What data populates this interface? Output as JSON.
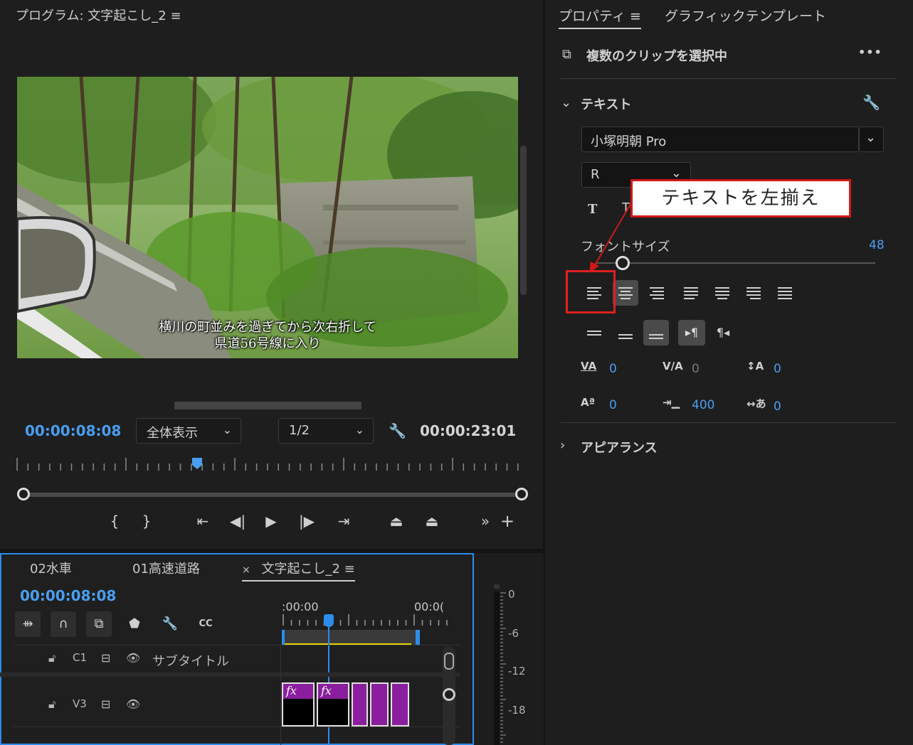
{
  "program": {
    "title": "プログラム: 文字起こし_2",
    "menu_icon": "≡",
    "subtitle_line1": "横川の町並みを過ぎてから次右折して",
    "subtitle_line2": "県道56号線に入り",
    "timecode_current": "00:00:08:08",
    "zoom_select": "全体表示",
    "resolution_select": "1/2",
    "timecode_duration": "00:00:23:01"
  },
  "timeline": {
    "tabs": [
      "02水車",
      "01高速道路",
      "文字起こし_2"
    ],
    "tab_close": "×",
    "tab_menu": "≡",
    "timecode": "00:00:08:08",
    "ruler_start": ":00:00",
    "ruler_end": "00:0(",
    "tracks": [
      {
        "lock": "🔓",
        "id": "C1",
        "name": "サブタイトル"
      },
      {
        "lock": "🔓",
        "id": "V3",
        "name": ""
      }
    ]
  },
  "meter": {
    "labels": [
      "0",
      "-6",
      "-12",
      "-18"
    ]
  },
  "properties": {
    "tabs": [
      "プロパティ",
      "グラフィックテンプレート"
    ],
    "tab_menu": "≡",
    "selection_label": "複数のクリップを選択中",
    "more_icon": "•••",
    "text_section": "テキスト",
    "font_family": "小塚明朝 Pro",
    "font_style": "R",
    "font_size_label": "フォントサイズ",
    "font_size_value": "48",
    "font_size_slider_fraction": 0.1,
    "kerning": "0",
    "tracking": "0",
    "leading": "0",
    "baseline": "0",
    "tab_width": "400",
    "tsume": "0",
    "appearance_section": "アピアランス"
  },
  "annotation": {
    "callout_text": "テキストを左揃え",
    "color": "#d01818"
  },
  "colors": {
    "accent_blue": "#4a9ef0",
    "clip_purple": "#8b1e9e",
    "playhead_blue": "#2d8ceb",
    "highlight_red": "#e02020"
  }
}
